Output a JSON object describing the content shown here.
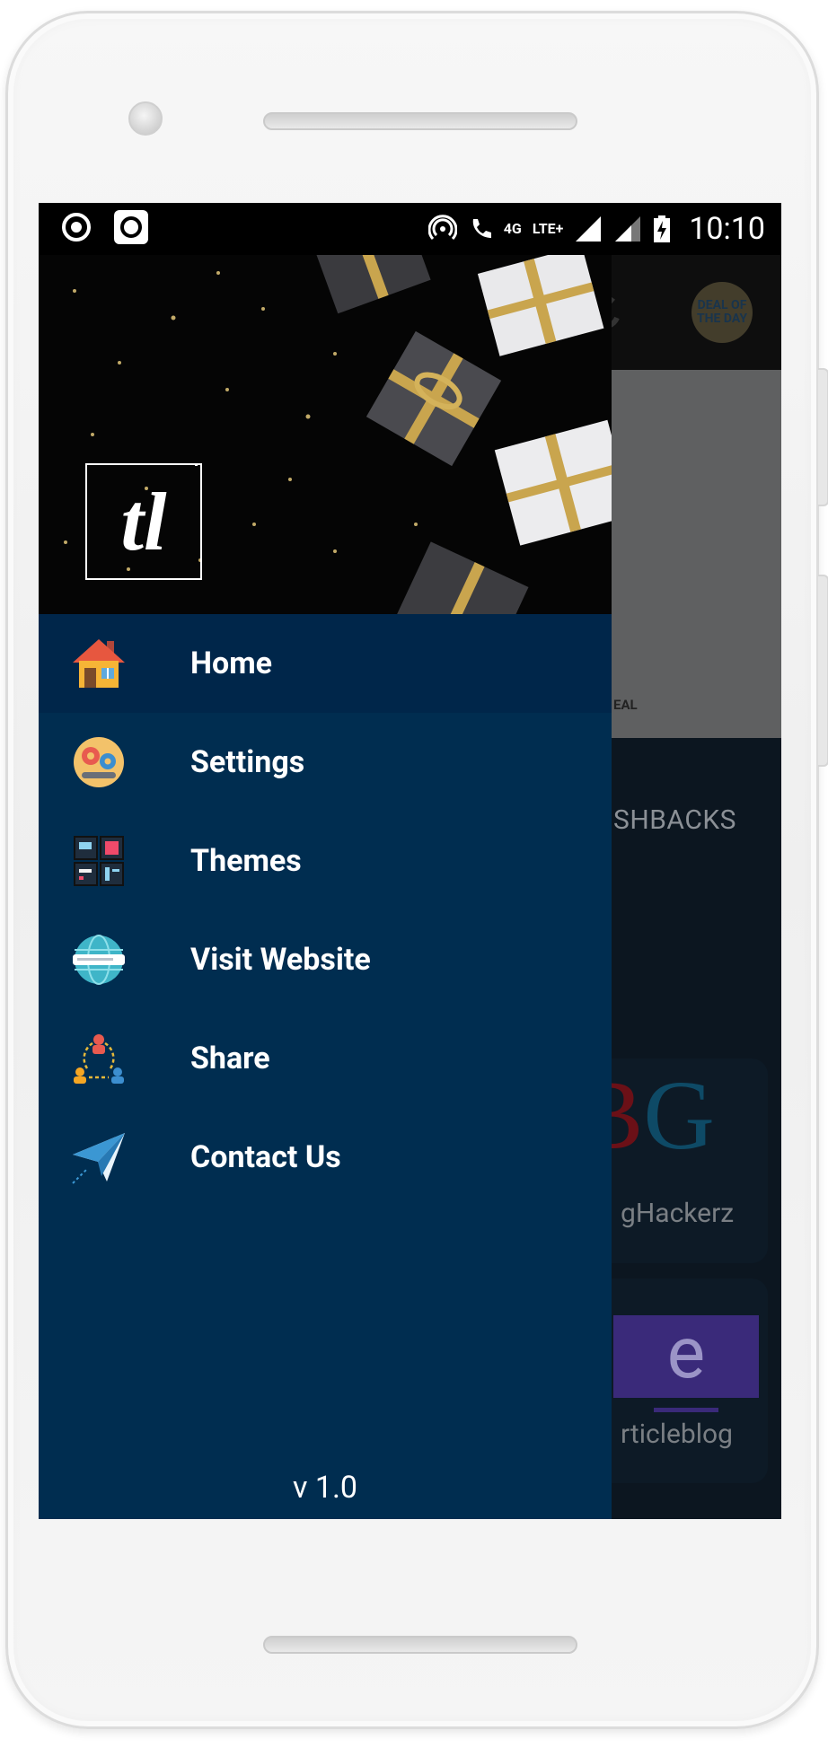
{
  "status_bar": {
    "network_4g": "4G",
    "network_lte": "LTE+",
    "time": "10:10"
  },
  "underlay": {
    "badge": "DEAL OF THE DAY",
    "banner_text": "EAL",
    "cashback_text": "SHBACKS",
    "card1_letters_b": "B",
    "card1_letters_g": "G",
    "card1_label": "gHackerz",
    "card2_letter": "e",
    "card2_label": "rticleblog"
  },
  "drawer": {
    "logo": "tl",
    "menu": [
      {
        "label": "Home",
        "icon": "home-icon",
        "active": true
      },
      {
        "label": "Settings",
        "icon": "settings-gears-icon",
        "active": false
      },
      {
        "label": "Themes",
        "icon": "themes-icon",
        "active": false
      },
      {
        "label": "Visit Website",
        "icon": "globe-icon",
        "active": false
      },
      {
        "label": "Share",
        "icon": "share-network-icon",
        "active": false
      },
      {
        "label": "Contact Us",
        "icon": "paper-plane-icon",
        "active": false
      }
    ],
    "version": "v 1.0"
  },
  "colors": {
    "drawer_bg": "#002d50",
    "drawer_active": "#00264a",
    "status_bar": "#000000"
  }
}
